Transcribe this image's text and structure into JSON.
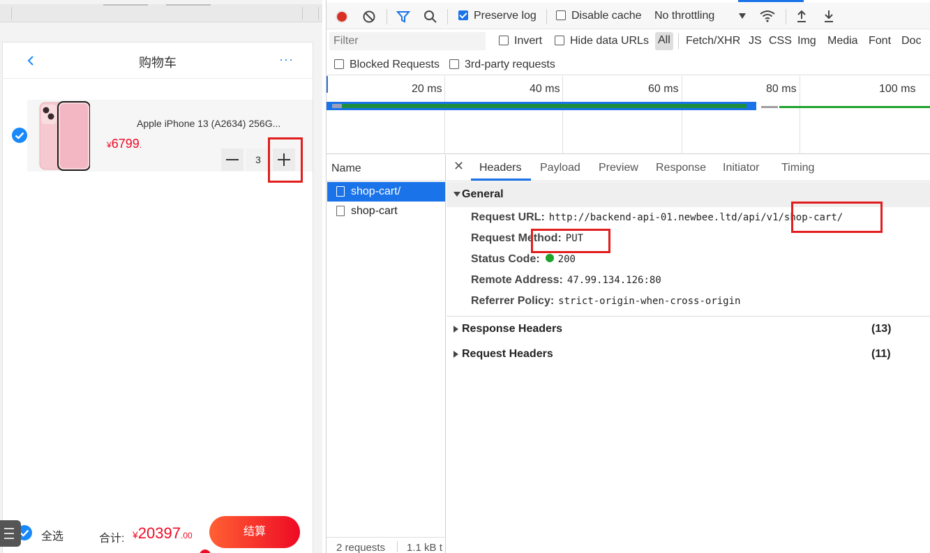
{
  "app": {
    "header": {
      "title": "购物车",
      "more": "···"
    },
    "item": {
      "title": "Apple iPhone 13 (A2634) 256G...",
      "price_symbol": "¥",
      "price_integer": "6799",
      "price_decimal": ".",
      "quantity": "3",
      "checked": true
    },
    "submit_bar": {
      "select_all": "全选",
      "total_label": "合计:",
      "total_symbol": "¥",
      "total_integer": "20397",
      "total_decimal": ".00",
      "checkout_label": "结算"
    },
    "colors": {
      "price": "#ee0a24",
      "accent": "#1989fa"
    }
  },
  "devtools": {
    "toolbar": {
      "preserve_log": "Preserve log",
      "preserve_log_checked": true,
      "disable_cache": "Disable cache",
      "throttling": "No throttling"
    },
    "filter": {
      "placeholder": "Filter",
      "invert": "Invert",
      "hide_data_urls": "Hide data URLs",
      "types": [
        "All",
        "Fetch/XHR",
        "JS",
        "CSS",
        "Img",
        "Media",
        "Font",
        "Doc"
      ],
      "blocked_requests": "Blocked Requests",
      "third_party": "3rd-party requests"
    },
    "timeline": {
      "ticks": [
        "20 ms",
        "40 ms",
        "60 ms",
        "80 ms",
        "100 ms"
      ]
    },
    "requests": {
      "header": "Name",
      "rows": [
        "shop-cart/",
        "shop-cart"
      ],
      "footer_count": "2 requests",
      "footer_size": "1.1 kB t"
    },
    "detail": {
      "tabs": [
        "Headers",
        "Payload",
        "Preview",
        "Response",
        "Initiator",
        "Timing"
      ],
      "active_tab": "Headers",
      "general": {
        "title": "General",
        "request_url_label": "Request URL:",
        "request_url": "http://backend-api-01.newbee.ltd/api/v1/shop-cart/",
        "method_label": "Request Method:",
        "method": "PUT",
        "status_label": "Status Code:",
        "status": "200",
        "remote_label": "Remote Address:",
        "remote": "47.99.134.126:80",
        "referrer_label": "Referrer Policy:",
        "referrer": "strict-origin-when-cross-origin"
      },
      "response_headers": {
        "title": "Response Headers",
        "count": "(13)"
      },
      "request_headers": {
        "title": "Request Headers",
        "count": "(11)"
      }
    },
    "colors": {
      "accent": "#1a73e8",
      "record": "#d93025",
      "status_ok": "#1fa32a",
      "annotation": "#e11d1d"
    }
  }
}
